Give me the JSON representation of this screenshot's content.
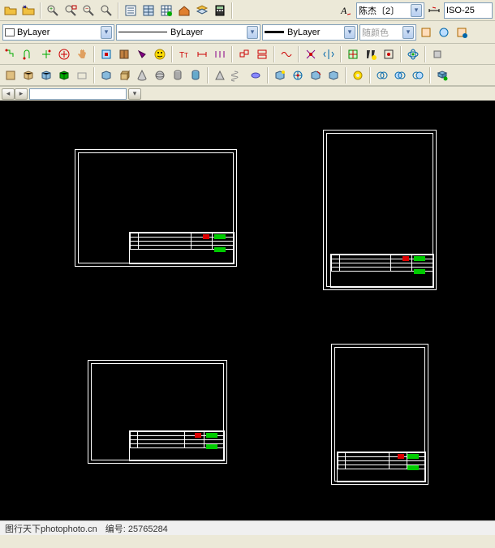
{
  "toolbar1": {
    "text_style_dropdown": "陈杰〔2〕",
    "dim_style_dropdown": "ISO-25"
  },
  "toolbar2": {
    "layer_dropdown": "ByLayer",
    "linetype_dropdown": "ByLayer",
    "lineweight_dropdown": "ByLayer",
    "color_dropdown": "随颜色"
  },
  "icons": {
    "row1": [
      "open",
      "open2",
      "zoom-in",
      "zoom-window",
      "zoom-out",
      "zoom-ext",
      "list",
      "table",
      "grid-edit",
      "house",
      "layers",
      "calc",
      "sep",
      "font-style",
      "sep",
      "brush"
    ],
    "row3": [
      "ortho",
      "snap",
      "polar",
      "plus-circle",
      "pan",
      "history",
      "book",
      "purge",
      "smiley",
      "sep",
      "tt-text",
      "dimension",
      "align",
      "sep",
      "hatch",
      "hatch2",
      "sep",
      "gradient",
      "sep",
      "array",
      "mirror",
      "sep",
      "block",
      "block-edit",
      "sep",
      "3d-orbit",
      "sep"
    ],
    "row4": [
      "box",
      "cube",
      "pyramid",
      "prism",
      "blank",
      "sep",
      "cyl",
      "box3d",
      "cone",
      "sphere",
      "wedge",
      "torus",
      "sep",
      "triangle",
      "spring",
      "helix",
      "sep",
      "render",
      "material",
      "light",
      "sep",
      "donut",
      "sep",
      "circle1",
      "circle2",
      "circle3",
      "sep",
      "boolean"
    ]
  },
  "footer": {
    "site": "图行天下photophoto.cn",
    "id_label": "编号:",
    "id_value": "25765284"
  }
}
